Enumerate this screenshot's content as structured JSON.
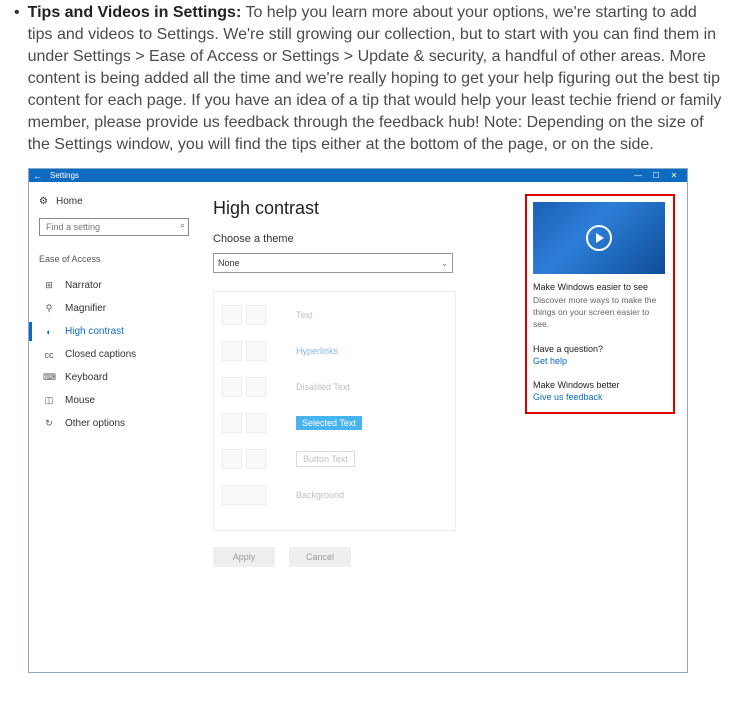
{
  "article": {
    "bold": "Tips and Videos in Settings:",
    "body": " To help you learn more about your options, we're starting to add tips and videos to Settings. We're still growing our collection, but to start with you can find them in under Settings > Ease of Access or Settings > Update & security, a handful of other areas. More content is being added all the time and we're really hoping to get your help figuring out the best tip content for each page. If you have an idea of a tip that would help your least techie friend or family member, please provide us feedback through the feedback hub! Note: Depending on the size of the Settings window, you will find the tips either at the bottom of the page, or on the side."
  },
  "titlebar": {
    "title": "Settings",
    "minimize": "—",
    "maximize": "☐",
    "close": "✕",
    "back": "←"
  },
  "sidebar": {
    "home_label": "Home",
    "search_placeholder": "Find a setting",
    "section_label": "Ease of Access",
    "items": [
      {
        "icon": "⊞",
        "label": "Narrator"
      },
      {
        "icon": "⚲",
        "label": "Magnifier"
      },
      {
        "icon": "◐",
        "label": "High contrast"
      },
      {
        "icon": "cc",
        "label": "Closed captions"
      },
      {
        "icon": "⌨",
        "label": "Keyboard"
      },
      {
        "icon": "◫",
        "label": "Mouse"
      },
      {
        "icon": "↻",
        "label": "Other options"
      }
    ]
  },
  "main": {
    "title": "High contrast",
    "choose_theme": "Choose a theme",
    "theme_value": "None",
    "preview": {
      "text": "Text",
      "hyperlinks": "Hyperlinks",
      "disabled_text": "Disabled Text",
      "selected_text": "Selected Text",
      "button_text": "Button Text",
      "background": "Background"
    },
    "apply": "Apply",
    "cancel": "Cancel"
  },
  "tips": {
    "video_title": "Make Windows easier to see",
    "video_desc": "Discover more ways to make the things on your screen easier to see.",
    "question": "Have a question?",
    "get_help": "Get help",
    "better": "Make Windows better",
    "feedback": "Give us feedback"
  }
}
